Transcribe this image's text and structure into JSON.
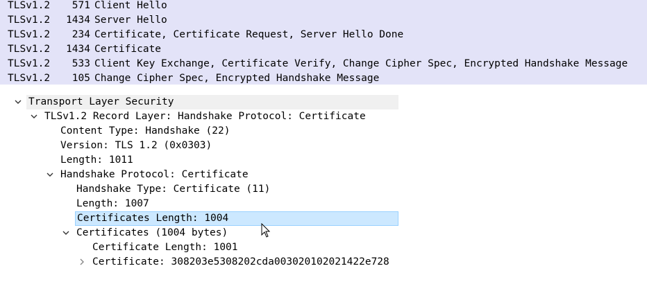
{
  "packet_list": {
    "rows": [
      {
        "protocol": "TLSv1.2",
        "length": "571",
        "info": "Client Hello"
      },
      {
        "protocol": "TLSv1.2",
        "length": "1434",
        "info": "Server Hello"
      },
      {
        "protocol": "TLSv1.2",
        "length": "234",
        "info": "Certificate, Certificate Request, Server Hello Done"
      },
      {
        "protocol": "TLSv1.2",
        "length": "1434",
        "info": "Certificate"
      },
      {
        "protocol": "TLSv1.2",
        "length": "533",
        "info": "Client Key Exchange, Certificate Verify, Change Cipher Spec, Encrypted Handshake Message"
      },
      {
        "protocol": "TLSv1.2",
        "length": "105",
        "info": "Change Cipher Spec, Encrypted Handshake Message"
      }
    ]
  },
  "detail_tree": {
    "tls": "Transport Layer Security",
    "record_layer": "TLSv1.2 Record Layer: Handshake Protocol: Certificate",
    "content_type": "Content Type: Handshake (22)",
    "version": "Version: TLS 1.2 (0x0303)",
    "length": "Length: 1011",
    "handshake_protocol": "Handshake Protocol: Certificate",
    "handshake_type": "Handshake Type: Certificate (11)",
    "handshake_length": "Length: 1007",
    "certificates_length": "Certificates Length: 1004",
    "certificates": "Certificates (1004 bytes)",
    "certificate_length": "Certificate Length: 1001",
    "certificate": "Certificate: 308203e5308202cda003020102021422e728"
  },
  "icons": {
    "expanded": "chevron-down-icon",
    "collapsed": "chevron-right-icon",
    "cursor": "mouse-pointer-icon"
  },
  "colors": {
    "packet_list_bg": "#e3e3f8",
    "selected_bg": "#cce8ff",
    "selected_border": "#99d1ff"
  }
}
